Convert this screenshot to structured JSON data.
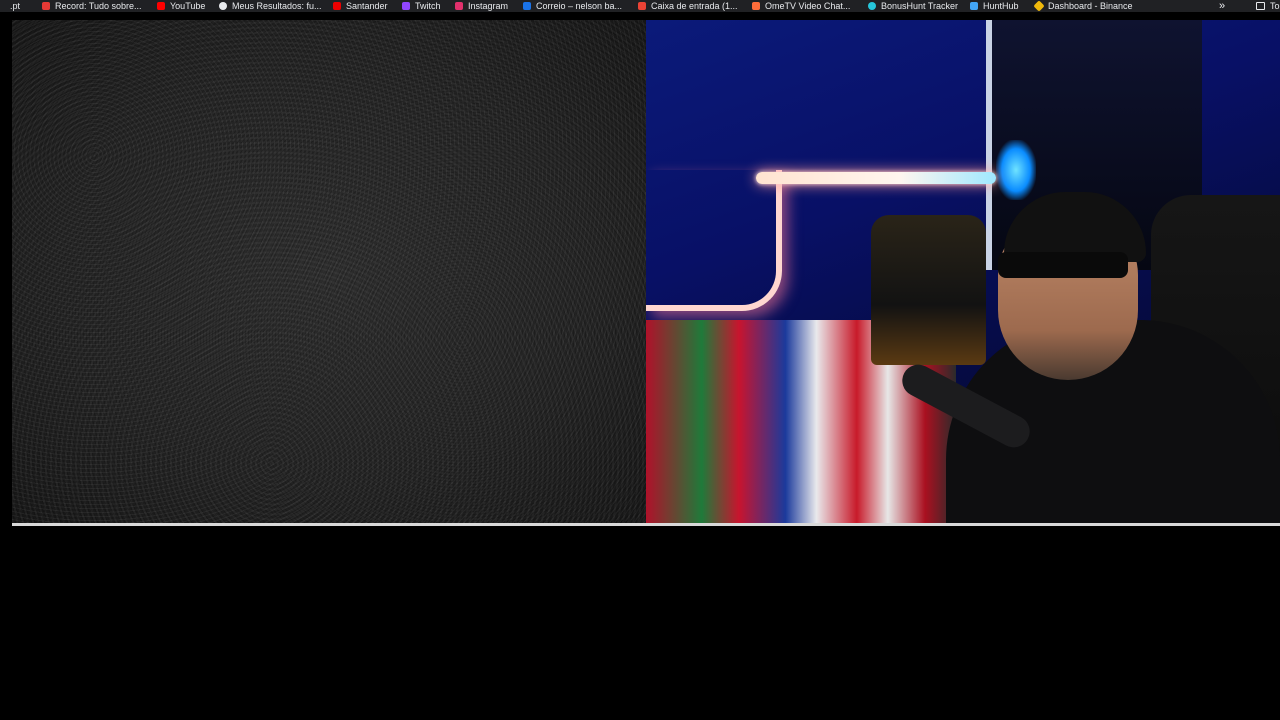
{
  "bookmarks_bar": {
    "items": [
      {
        "label": ".pt",
        "icon": "page-icon",
        "color": "#9aa0a6"
      },
      {
        "label": "Record: Tudo sobre...",
        "icon": "record-icon",
        "color": "#e53935"
      },
      {
        "label": "YouTube",
        "icon": "youtube-icon",
        "color": "#ff0000"
      },
      {
        "label": "Meus Resultados: fu...",
        "icon": "results-icon",
        "color": "#e8eaed"
      },
      {
        "label": "Santander",
        "icon": "santander-icon",
        "color": "#ec0000"
      },
      {
        "label": "Twitch",
        "icon": "twitch-icon",
        "color": "#9146ff"
      },
      {
        "label": "Instagram",
        "icon": "instagram-icon",
        "color": "#e1306c"
      },
      {
        "label": "Correio – nelson ba...",
        "icon": "mail-icon",
        "color": "#1a73e8"
      },
      {
        "label": "Caixa de entrada (1...",
        "icon": "gmail-icon",
        "color": "#ea4335"
      },
      {
        "label": "OmeTV Video Chat...",
        "icon": "ometv-icon",
        "color": "#ff6d3a"
      },
      {
        "label": "BonusHunt Tracker",
        "icon": "bonushunt-icon",
        "color": "#26c6da"
      },
      {
        "label": "HuntHub",
        "icon": "hunthub-icon",
        "color": "#42a5f5"
      },
      {
        "label": "Dashboard - Binance",
        "icon": "binance-icon",
        "color": "#f0b90b"
      }
    ],
    "overflow_label": "»",
    "folder_label": "To"
  }
}
